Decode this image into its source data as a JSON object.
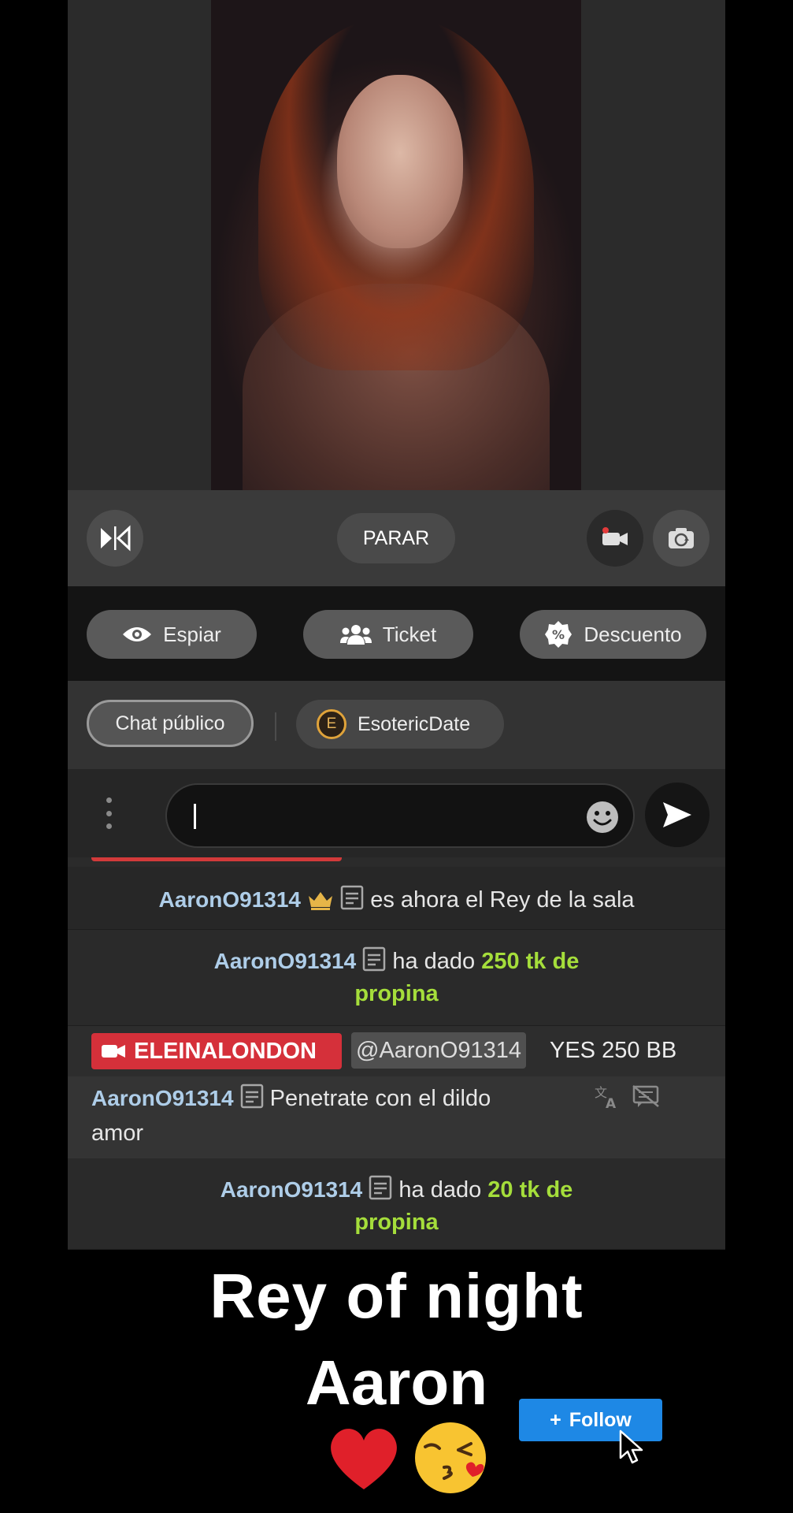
{
  "controls": {
    "stop_label": "PARAR"
  },
  "actions": {
    "spy_label": "Espiar",
    "ticket_label": "Ticket",
    "discount_label": "Descuento"
  },
  "tabs": {
    "public_label": "Chat público",
    "private_label": "EsotericDate",
    "private_avatar_letter": "E"
  },
  "composer": {
    "placeholder": ""
  },
  "chat": {
    "king_user": "AaronO91314",
    "king_text": "es ahora el Rey de la sala",
    "tip1_user": "AaronO91314",
    "tip1_text": "ha dado",
    "tip1_amount": "250 tk de propina",
    "model_name": "ELEINALONDON",
    "model_mention": "@AaronO91314",
    "model_text": "YES 250 BB",
    "user_name": "AaronO91314",
    "user_text": "Penetrate con el dildo amor",
    "tip2_user": "AaronO91314",
    "tip2_text": "ha dado",
    "tip2_amount": "20 tk de propina"
  },
  "overlay": {
    "caption_line1": "Rey of night",
    "caption_line2": "Aaron",
    "emojis": "❤️😘",
    "follow_label": "Follow",
    "follow_icon": "+"
  },
  "colors": {
    "tip_green": "#a5de3b",
    "username_blue": "#aecde8",
    "model_red": "#d5303a",
    "follow_blue": "#1e88e5"
  }
}
